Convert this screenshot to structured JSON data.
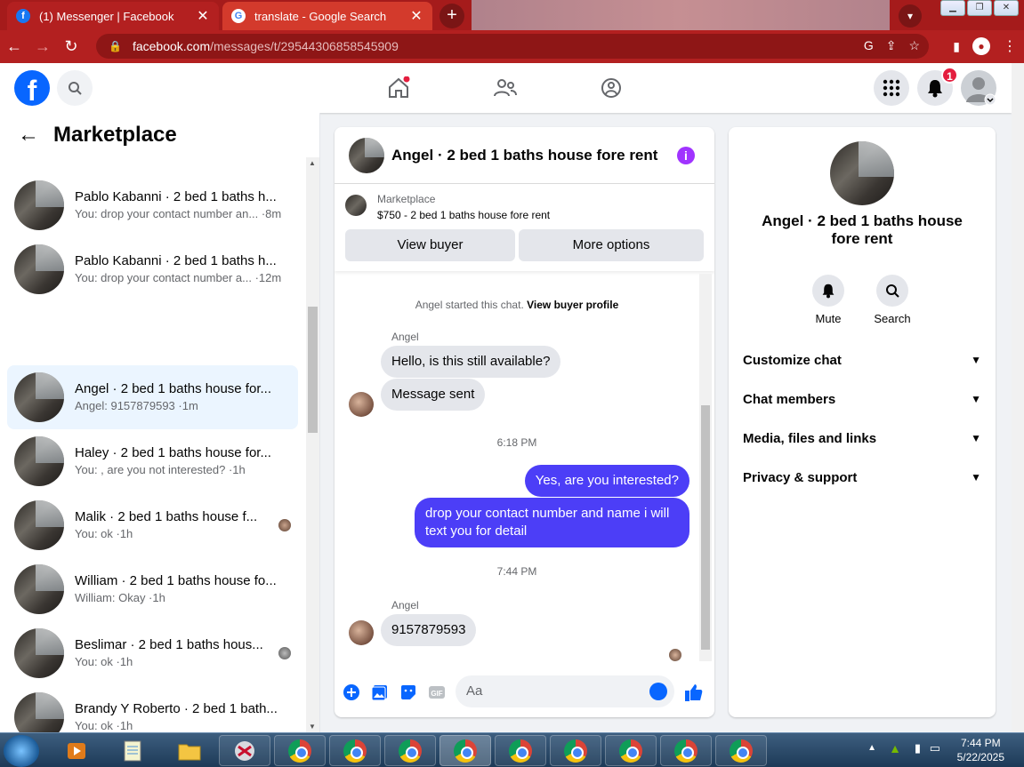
{
  "browser": {
    "tabs": [
      {
        "title": "(1) Messenger | Facebook",
        "close": "✕"
      },
      {
        "title": "translate - Google Search",
        "close": "✕"
      }
    ],
    "new_tab": "+",
    "url_host": "facebook.com",
    "url_path": "/messages/t/29544306858545909"
  },
  "fb_header": {
    "notification_count": "1"
  },
  "left_panel": {
    "title": "Marketplace",
    "conversations": [
      {
        "name": "Pablo Kabanni · 2 bed 1 baths h...",
        "snippet": "You: drop your contact number an... ·8m"
      },
      {
        "name": "Pablo Kabanni · 2 bed 1 baths h...",
        "snippet": "You: drop your contact number a... ·12m"
      },
      {
        "name": "Angel · 2 bed 1 baths house for...",
        "snippet": "Angel: 9157879593 ·1m"
      },
      {
        "name": "Haley · 2 bed 1 baths house for...",
        "snippet": "You: , are you not interested? ·1h"
      },
      {
        "name": "Malik · 2 bed 1 baths house f...",
        "snippet": "You: ok ·1h"
      },
      {
        "name": "William · 2 bed 1 baths house fo...",
        "snippet": "William: Okay ·1h"
      },
      {
        "name": "Beslimar · 2 bed 1 baths hous...",
        "snippet": "You: ok ·1h"
      },
      {
        "name": "Brandy Y Roberto · 2 bed 1 bath...",
        "snippet": "You: ok ·1h"
      }
    ]
  },
  "chat": {
    "title": "Angel · 2 bed 1 baths house fore rent",
    "marketplace_label": "Marketplace",
    "listing": "$750 - 2 bed 1 baths house fore rent",
    "view_buyer": "View buyer",
    "more_options": "More options",
    "started_text": "Angel started this chat.",
    "view_buyer_profile": "View buyer profile",
    "sender": "Angel",
    "msg1": "Hello, is this still available?",
    "msg2": "Message sent",
    "time1": "6:18 PM",
    "out1": "Yes, are you interested?",
    "out2": "drop your contact number and name i will text you for detail",
    "time2": "7:44 PM",
    "msg3": "9157879593",
    "composer_placeholder": "Aa"
  },
  "right_panel": {
    "name": "Angel · 2 bed 1 baths house fore rent",
    "mute": "Mute",
    "search": "Search",
    "rows": [
      "Customize chat",
      "Chat members",
      "Media, files and links",
      "Privacy & support"
    ]
  },
  "taskbar": {
    "time": "7:44 PM",
    "date": "5/22/2025"
  },
  "colors": {
    "browser_red": "#b32020",
    "fb_blue": "#0866ff",
    "outgoing_bubble": "#4c3ef7",
    "selected_conv": "#ebf5ff"
  }
}
